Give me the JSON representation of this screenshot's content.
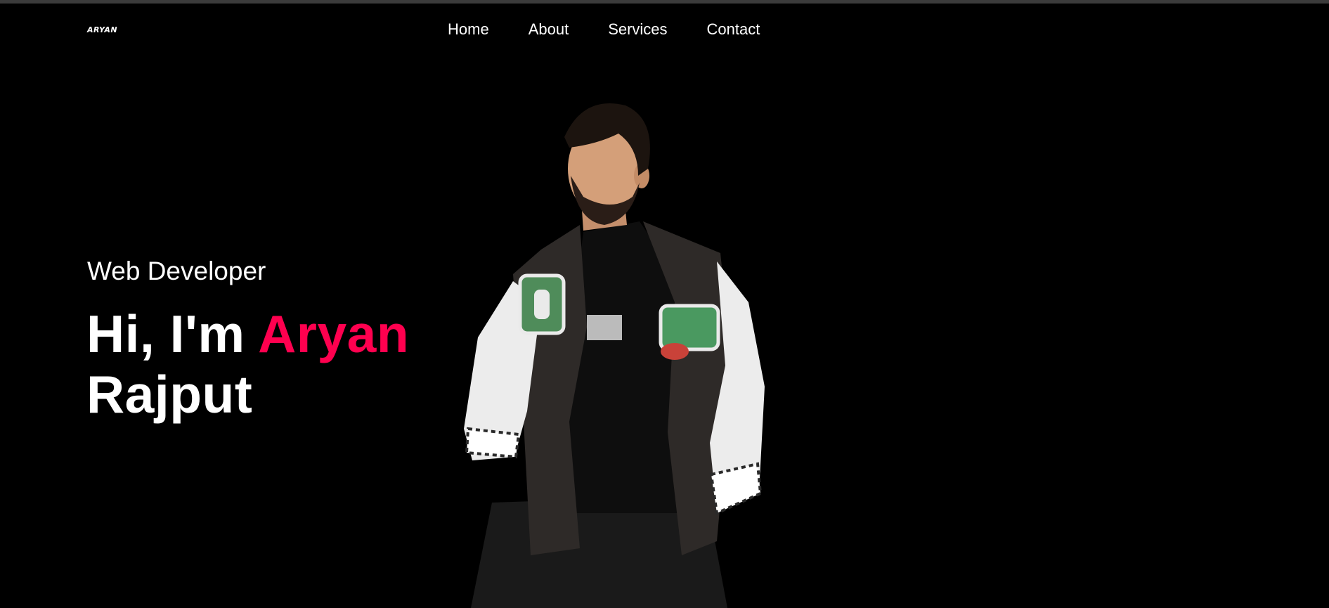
{
  "header": {
    "logo": "ARYAN",
    "nav": [
      "Home",
      "About",
      "Services",
      "Contact"
    ]
  },
  "hero": {
    "subtitle": "Web Developer",
    "greeting": "Hi, I'm ",
    "first_name": "Aryan",
    "last_name": "Rajput",
    "accent_color": "#ff004f",
    "image": "portrait-photo"
  }
}
